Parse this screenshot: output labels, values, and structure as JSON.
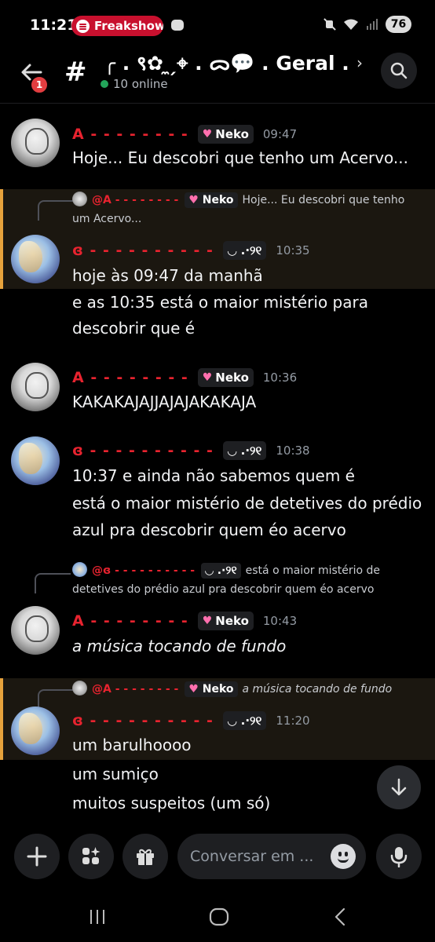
{
  "status_bar": {
    "time": "11:21",
    "spotify_text": "Freakshow",
    "battery": "76"
  },
  "header": {
    "back_badge": "1",
    "channel_name": "╭ . ९✿ ̼ ̗⌖ . ᯅ💬 . Geral . …",
    "online_text": "10 online"
  },
  "messages": [
    {
      "author": "A ‑ ‑ ‑ ‑ ‑ ‑ ‑ ‑",
      "tag": "Neko",
      "time": "09:47",
      "avatar": "A",
      "lines": [
        "Hoje... Eu descobri que tenho um Acervo..."
      ]
    },
    {
      "highlight": true,
      "reply": {
        "author": "@A ‑ ‑ ‑ ‑ ‑ ‑ ‑ ‑",
        "tag": "Neko",
        "text": "Hoje... Eu descobri que tenho um Acervo..."
      },
      "author": "ɞ ‑ ‑ ‑ ‑ ‑ ‑ ‑ ‑ ‑ ‑",
      "tag": "◡ .·୨୧",
      "time": "10:35",
      "avatar": "B",
      "lines": [
        "hoje às 09:47 da manhã"
      ]
    },
    {
      "continuation": true,
      "lines": [
        "e as 10:35 está o maior mistério para",
        "descobrir que é"
      ]
    },
    {
      "author": "A ‑ ‑ ‑ ‑ ‑ ‑ ‑ ‑",
      "tag": "Neko",
      "time": "10:36",
      "avatar": "A",
      "lines": [
        "KAKAKAJAJJAJAJAKAKAJA"
      ]
    },
    {
      "author": "ɞ ‑ ‑ ‑ ‑ ‑ ‑ ‑ ‑ ‑ ‑",
      "tag": "◡ .·୨୧",
      "time": "10:38",
      "avatar": "B",
      "lines": [
        "10:37 e ainda não sabemos quem é",
        "está o maior mistério de detetives do prédio",
        "azul pra descobrir quem éo acervo"
      ]
    },
    {
      "reply": {
        "author": "@ɞ ‑ ‑ ‑ ‑ ‑ ‑ ‑ ‑ ‑ ‑",
        "tag": "◡ .·୨୧",
        "text": "está o maior mistério de detetives do prédio azul pra descobrir quem éo acervo"
      },
      "author": "A ‑ ‑ ‑ ‑ ‑ ‑ ‑ ‑",
      "tag": "Neko",
      "time": "10:43",
      "avatar": "A",
      "lines": [
        "a música tocando de fundo"
      ]
    },
    {
      "highlight": true,
      "reply": {
        "author": "@A ‑ ‑ ‑ ‑ ‑ ‑ ‑ ‑",
        "tag": "Neko",
        "text": "a música tocando de fundo"
      },
      "author": "ɞ ‑ ‑ ‑ ‑ ‑ ‑ ‑ ‑ ‑ ‑",
      "tag": "◡ .·୨୧",
      "time": "11:20",
      "avatar": "B",
      "lines": [
        "um barulhoooo"
      ]
    },
    {
      "continuation": true,
      "lines": [
        "um sumiço",
        "muitos suspeitos (um só)"
      ]
    }
  ],
  "input": {
    "placeholder": "Conversar em ..."
  }
}
